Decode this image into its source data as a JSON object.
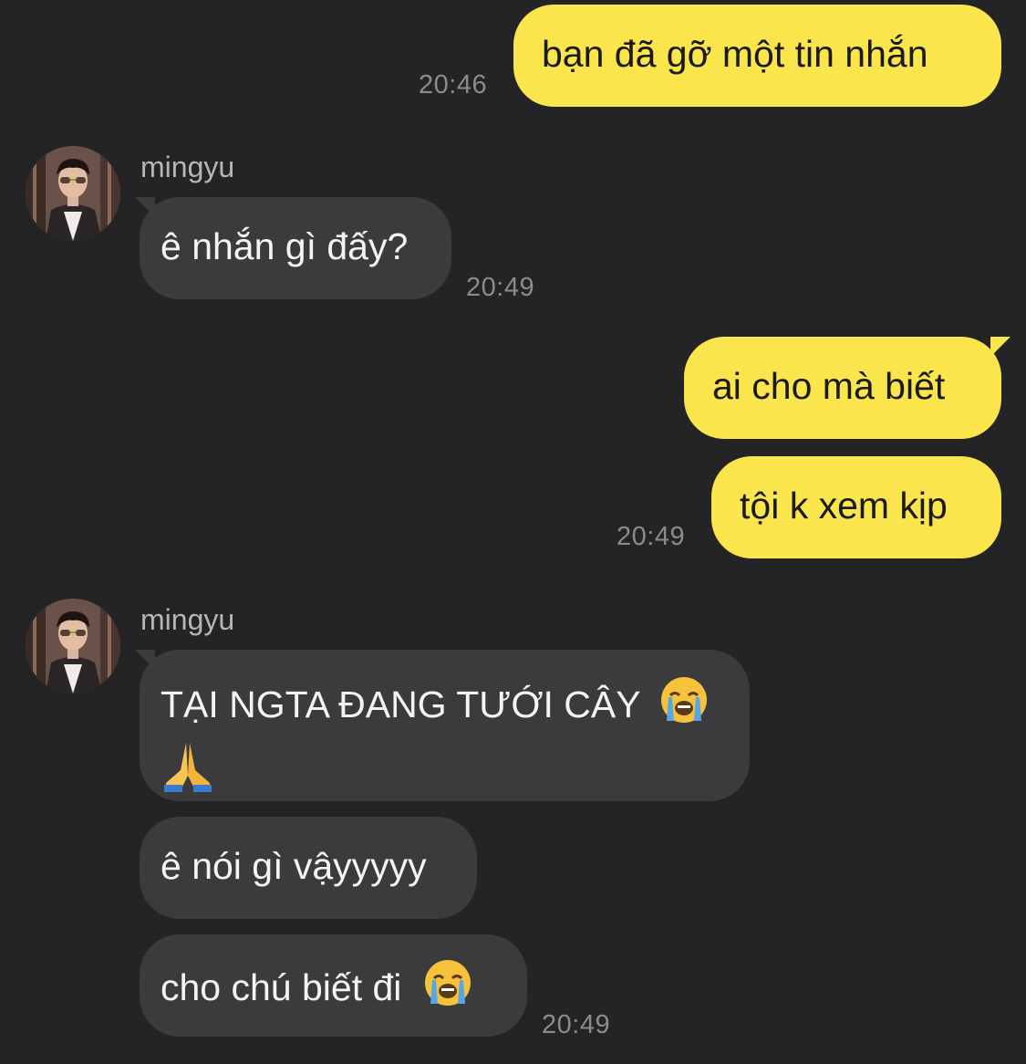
{
  "chat": {
    "messages": [
      {
        "sender": "me",
        "text": "bạn đã gỡ một tin nhắn",
        "time": "20:46"
      },
      {
        "sender": "mingyu",
        "text": "ê nhắn gì đấy?",
        "time": "20:49"
      },
      {
        "sender": "me",
        "text": "ai cho mà biết"
      },
      {
        "sender": "me",
        "text": "tội k xem kịp",
        "time": "20:49"
      },
      {
        "sender": "mingyu",
        "text_line1": "TẠI NGTA ĐANG TƯỚI CÂY",
        "emoji1": "loudly-crying-face",
        "emoji2": "folded-hands"
      },
      {
        "sender": "mingyu",
        "text": "ê nói gì vậyyyyy"
      },
      {
        "sender": "mingyu",
        "text": "cho chú biết đi",
        "emoji": "loudly-crying-face",
        "time": "20:49"
      }
    ],
    "contact": {
      "name": "mingyu"
    }
  },
  "colors": {
    "background": "#242427",
    "outgoing_bubble": "#fae54d",
    "incoming_bubble": "#3b3b3e",
    "timestamp": "#8b8b8e",
    "name": "#b6b6b9"
  }
}
